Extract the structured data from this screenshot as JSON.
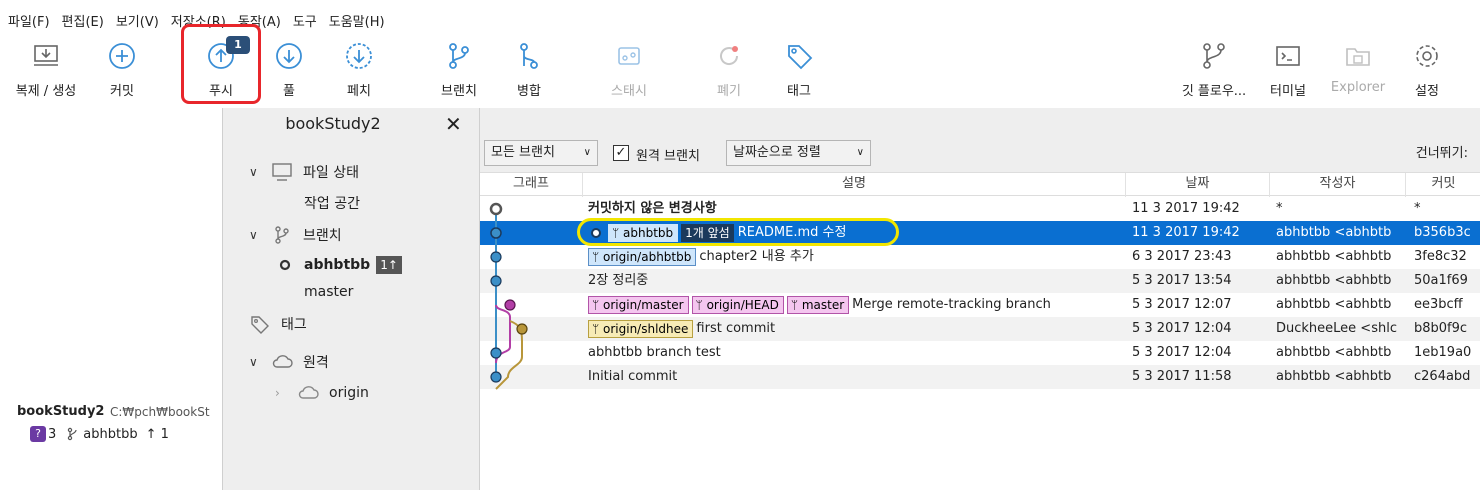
{
  "menu": [
    "파일(F)",
    "편집(E)",
    "보기(V)",
    "저장소(R)",
    "동작(A)",
    "도구",
    "도움말(H)"
  ],
  "toolbar": {
    "clone": "복제 / 생성",
    "commit": "커밋",
    "push": "푸시",
    "push_badge": "1",
    "pull": "풀",
    "fetch": "페치",
    "branch": "브랜치",
    "merge": "병합",
    "stash": "스태시",
    "discard": "폐기",
    "tag": "태그",
    "gitflow": "깃 플로우...",
    "terminal": "터미널",
    "explorer": "Explorer",
    "settings": "설정"
  },
  "left": {
    "project_name": "bookStudy2",
    "project_path": "C:₩pch₩bookSt",
    "changes_count": "3",
    "branch": "abhbtbb",
    "ahead": "↑ 1"
  },
  "sidebar": {
    "title": "bookStudy2",
    "file_status": "파일 상태",
    "working_copy": "작업 공간",
    "branches": "브랜치",
    "current_branch": "abhbtbb",
    "current_branch_badge": "1↑",
    "master": "master",
    "tags": "태그",
    "remotes": "원격",
    "origin": "origin"
  },
  "filters": {
    "branches": "모든 브랜치",
    "remote_label": "원격 브랜치",
    "remote_checked": true,
    "sort": "날짜순으로 정렬",
    "skip": "건너뛰기:"
  },
  "columns": {
    "graph": "그래프",
    "description": "설명",
    "date": "날짜",
    "author": "작성자",
    "commit": "커밋"
  },
  "commits": [
    {
      "desc": "커밋하지 않은 변경사항",
      "date": "11 3 2017 19:42",
      "author": "*",
      "hash": "*"
    },
    {
      "ref_current": "abhbtbb",
      "ahead": "1개 앞섬",
      "desc": "README.md 수정",
      "date": "11 3 2017 19:42",
      "author": "abhbtbb <abhbtb",
      "hash": "b356b3c"
    },
    {
      "ref1": "origin/abhbtbb",
      "desc": "chapter2 내용 추가",
      "date": "6 3 2017 23:43",
      "author": "abhbtbb <abhbtb",
      "hash": "3fe8c32"
    },
    {
      "desc": "2장 정리중",
      "date": "5 3 2017 13:54",
      "author": "abhbtbb <abhbtb",
      "hash": "50a1f69"
    },
    {
      "ref1": "origin/master",
      "ref2": "origin/HEAD",
      "ref3": "master",
      "desc": "Merge remote-tracking branch",
      "date": "5 3 2017 12:07",
      "author": "abhbtbb <abhbtb",
      "hash": "ee3bcff"
    },
    {
      "ref1": "origin/shldhee",
      "desc": "first commit",
      "date": "5 3 2017 12:04",
      "author": "DuckheeLee <shlc",
      "hash": "b8b0f9c"
    },
    {
      "desc": "abhbtbb branch test",
      "date": "5 3 2017 12:04",
      "author": "abhbtbb <abhbtb",
      "hash": "1eb19a0"
    },
    {
      "desc": "Initial commit",
      "date": "5 3 2017 11:58",
      "author": "abhbtbb <abhbtb",
      "hash": "c264abd"
    }
  ],
  "colors": {
    "selection": "#0a6fd1",
    "push_highlight": "#e8262b",
    "graph_blue": "#3b8fc7",
    "graph_pink": "#b23ea6",
    "graph_gold": "#b8963a"
  }
}
